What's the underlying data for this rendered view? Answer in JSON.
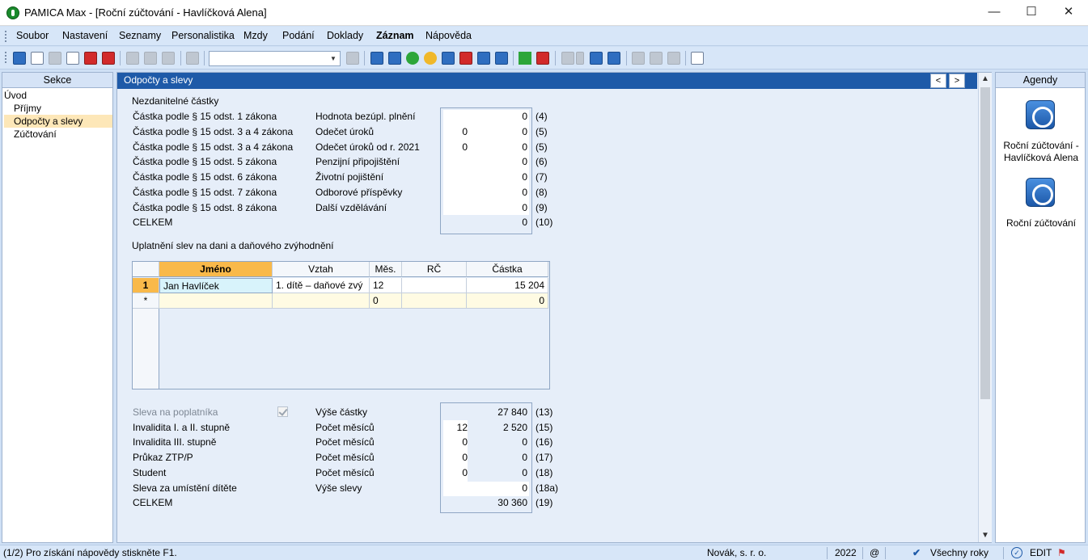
{
  "window": {
    "title": "PAMICA Max - [Roční zúčtování - Havlíčková Alena]",
    "minimize": "—",
    "maximize": "☐",
    "close": "✕"
  },
  "menu": [
    "Soubor",
    "Nastavení",
    "Seznamy",
    "Personalistika",
    "Mzdy",
    "Podání",
    "Doklady",
    "Záznam",
    "Nápověda"
  ],
  "toolbar": {
    "combo_value": ""
  },
  "sekce": {
    "title": "Sekce",
    "items": [
      "Úvod",
      "Příjmy",
      "Odpočty a slevy",
      "Zúčtování"
    ],
    "selected": 2
  },
  "main": {
    "header": "Odpočty a slevy",
    "nav_prev": "<",
    "nav_next": ">",
    "nezdanitelne": {
      "title": "Nezdanitelné částky",
      "rows": [
        {
          "law": "Částka podle § 15 odst. 1 zákona",
          "label": "Hodnota bezúpl. plnění",
          "a": "",
          "b": "0",
          "code": "(4)"
        },
        {
          "law": "Částka podle § 15 odst. 3 a 4 zákona",
          "label": "Odečet úroků",
          "a": "0",
          "b": "0",
          "code": "(5)"
        },
        {
          "law": "Částka podle § 15 odst. 3 a 4 zákona",
          "label": "Odečet úroků od r. 2021",
          "a": "0",
          "b": "0",
          "code": "(5)"
        },
        {
          "law": "Částka podle § 15 odst. 5 zákona",
          "label": "Penzijní připojištění",
          "a": "",
          "b": "0",
          "code": "(6)"
        },
        {
          "law": "Částka podle § 15 odst. 6 zákona",
          "label": "Životní pojištění",
          "a": "",
          "b": "0",
          "code": "(7)"
        },
        {
          "law": "Částka podle § 15 odst. 7 zákona",
          "label": "Odborové příspěvky",
          "a": "",
          "b": "0",
          "code": "(8)"
        },
        {
          "law": "Částka podle § 15 odst. 8 zákona",
          "label": "Další vzdělávání",
          "a": "",
          "b": "0",
          "code": "(9)"
        }
      ],
      "total_label": "CELKEM",
      "total_value": "0",
      "total_code": "(10)"
    },
    "slevy": {
      "title": "Uplatnění slev na dani a daňového zvýhodnění",
      "columns": [
        "Jméno",
        "Vztah",
        "Měs.",
        "RČ",
        "Částka"
      ],
      "rows": [
        {
          "num": "1",
          "name": "Jan Havlíček",
          "vztah": "1. dítě – daňové zvý",
          "mes": "12",
          "rc": "",
          "castka": "15 204"
        },
        {
          "num": "*",
          "name": "",
          "vztah": "",
          "mes": "0",
          "rc": "",
          "castka": "0"
        }
      ]
    },
    "slevy_dane": {
      "rows": [
        {
          "left": "Sleva na poplatníka",
          "label": "Výše částky",
          "a": "",
          "b": "27 840",
          "code": "(13)"
        },
        {
          "left": "Invalidita I. a II. stupně",
          "label": "Počet měsíců",
          "a": "12",
          "b": "2 520",
          "code": "(15)"
        },
        {
          "left": "Invalidita III. stupně",
          "label": "Počet měsíců",
          "a": "0",
          "b": "0",
          "code": "(16)"
        },
        {
          "left": "Průkaz ZTP/P",
          "label": "Počet měsíců",
          "a": "0",
          "b": "0",
          "code": "(17)"
        },
        {
          "left": "Student",
          "label": "Počet měsíců",
          "a": "0",
          "b": "0",
          "code": "(18)"
        },
        {
          "left": "Sleva za umístění dítěte",
          "label": "Výše slevy",
          "a": "",
          "b": "0",
          "code": "(18a)"
        }
      ],
      "total_label": "CELKEM",
      "total_value": "30 360",
      "total_code": "(19)"
    }
  },
  "agendy": {
    "title": "Agendy",
    "items": [
      {
        "line1": "Roční zúčtování -",
        "line2": "Havlíčková Alena"
      },
      {
        "line1": "Roční zúčtování",
        "line2": ""
      }
    ]
  },
  "status": {
    "hint": "(1/2) Pro získání nápovědy stiskněte F1.",
    "company": "Novák, s. r. o.",
    "year": "2022",
    "at": "@",
    "years": "Všechny roky",
    "mode": "EDIT"
  }
}
